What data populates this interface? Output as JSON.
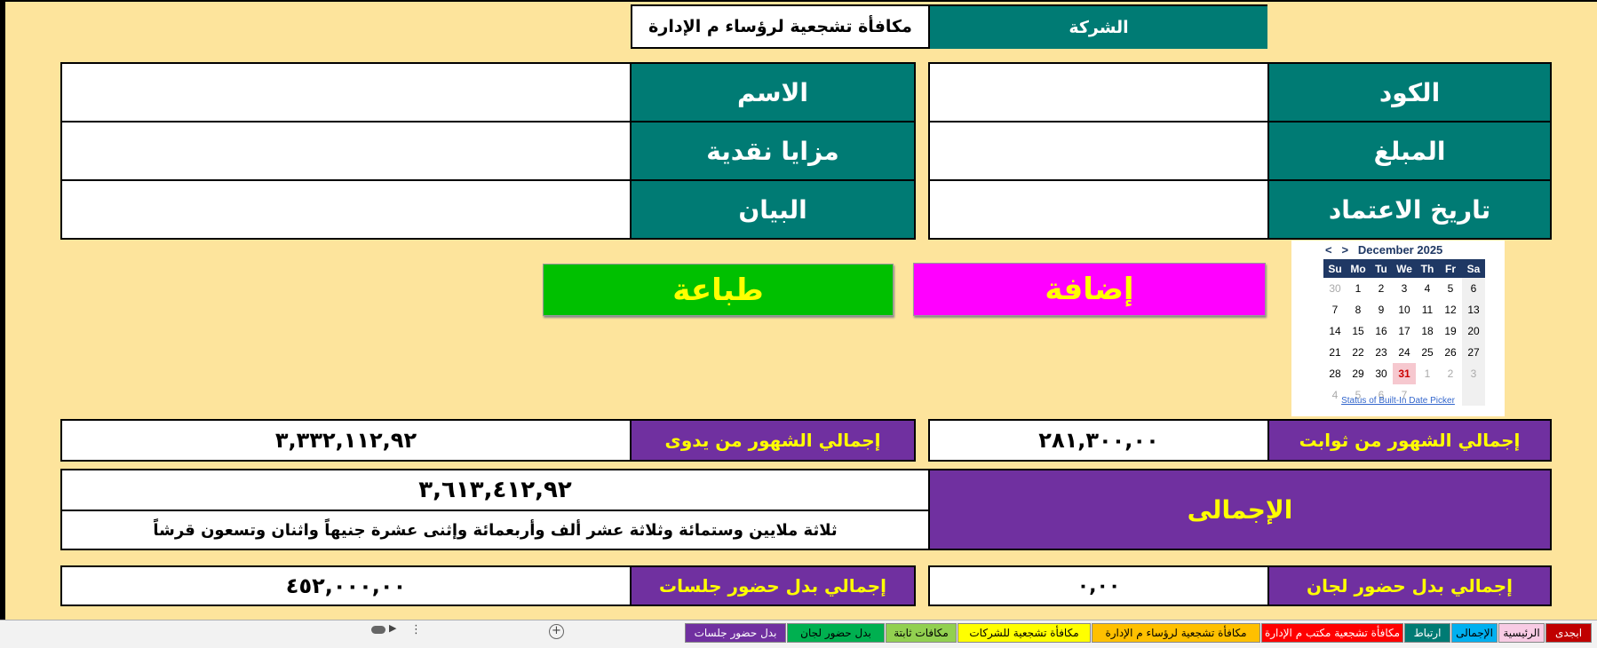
{
  "header": {
    "company_label": "الشركة",
    "title": "مكافأة تشجعية لرؤساء م الإدارة"
  },
  "form": {
    "code_label": "الكود",
    "code_value": "",
    "name_label": "الاسم",
    "name_value": "",
    "amount_label": "المبلغ",
    "amount_value": "",
    "cash_label": "مزايا نقدية",
    "cash_value": "",
    "date_label": "تاريخ الاعتماد",
    "date_value": "",
    "desc_label": "البيان",
    "desc_value": ""
  },
  "buttons": {
    "add": "إضافة",
    "print": "طباعة"
  },
  "calendar": {
    "prev": "<",
    "next": ">",
    "month": "December 2025",
    "days": [
      "Su",
      "Mo",
      "Tu",
      "We",
      "Th",
      "Fr",
      "Sa"
    ],
    "weeks": [
      [
        "30",
        "1",
        "2",
        "3",
        "4",
        "5",
        "6"
      ],
      [
        "7",
        "8",
        "9",
        "10",
        "11",
        "12",
        "13"
      ],
      [
        "14",
        "15",
        "16",
        "17",
        "18",
        "19",
        "20"
      ],
      [
        "21",
        "22",
        "23",
        "24",
        "25",
        "26",
        "27"
      ],
      [
        "28",
        "29",
        "30",
        "31",
        "1",
        "2",
        "3"
      ],
      [
        "4",
        "5",
        "6",
        "7",
        "",
        "",
        " "
      ]
    ],
    "status_link": "Status of Built-In Date Picker"
  },
  "totals": {
    "fixed_label": "إجمالي الشهور من ثوابت",
    "fixed_value": "٢٨١,٣٠٠,٠٠",
    "manual_label": "إجمالي الشهور من يدوى",
    "manual_value": "٣,٣٣٢,١١٢,٩٢",
    "grand_label": "الإجمالى",
    "grand_value": "٣,٦١٣,٤١٢,٩٢",
    "grand_words": "ثلاثة ملايين وستمائة وثلاثة عشر ألف وأربعمائة وإثنى عشرة جنيهاً واثنان وتسعون قرشاً",
    "committee_label": "إجمالي بدل حضور لجان",
    "committee_value": "٠,٠٠",
    "sessions_label": "إجمالي بدل حضور جلسات",
    "sessions_value": "٤٥٢,٠٠٠,٠٠"
  },
  "tabs": [
    {
      "label": "ابجدى",
      "bg": "#c00000",
      "fg": "#ffffff"
    },
    {
      "label": "الرئيسية",
      "bg": "#f8cbe4",
      "fg": "#000000"
    },
    {
      "label": "الإجمالى",
      "bg": "#00b0f0",
      "fg": "#000000"
    },
    {
      "label": "ارتباط",
      "bg": "#007b74",
      "fg": "#ffffff"
    },
    {
      "label": "مكافأة تشجعية مكتب م الإدارة",
      "bg": "#ff0000",
      "fg": "#ffffff"
    },
    {
      "label": "مكافأة تشجعية لرؤساء م الإدارة",
      "bg": "#ffc000",
      "fg": "#000000"
    },
    {
      "label": "مكافأة تشجعية للشركات",
      "bg": "#ffff00",
      "fg": "#000000"
    },
    {
      "label": "مكافات ثابتة",
      "bg": "#92d050",
      "fg": "#000000"
    },
    {
      "label": "بدل حضور لجان",
      "bg": "#00b050",
      "fg": "#000000"
    },
    {
      "label": "بدل حضور جلسات",
      "bg": "#7030a0",
      "fg": "#ffffff"
    }
  ],
  "sheet_nav": {
    "more": "⋮",
    "add": "+"
  }
}
